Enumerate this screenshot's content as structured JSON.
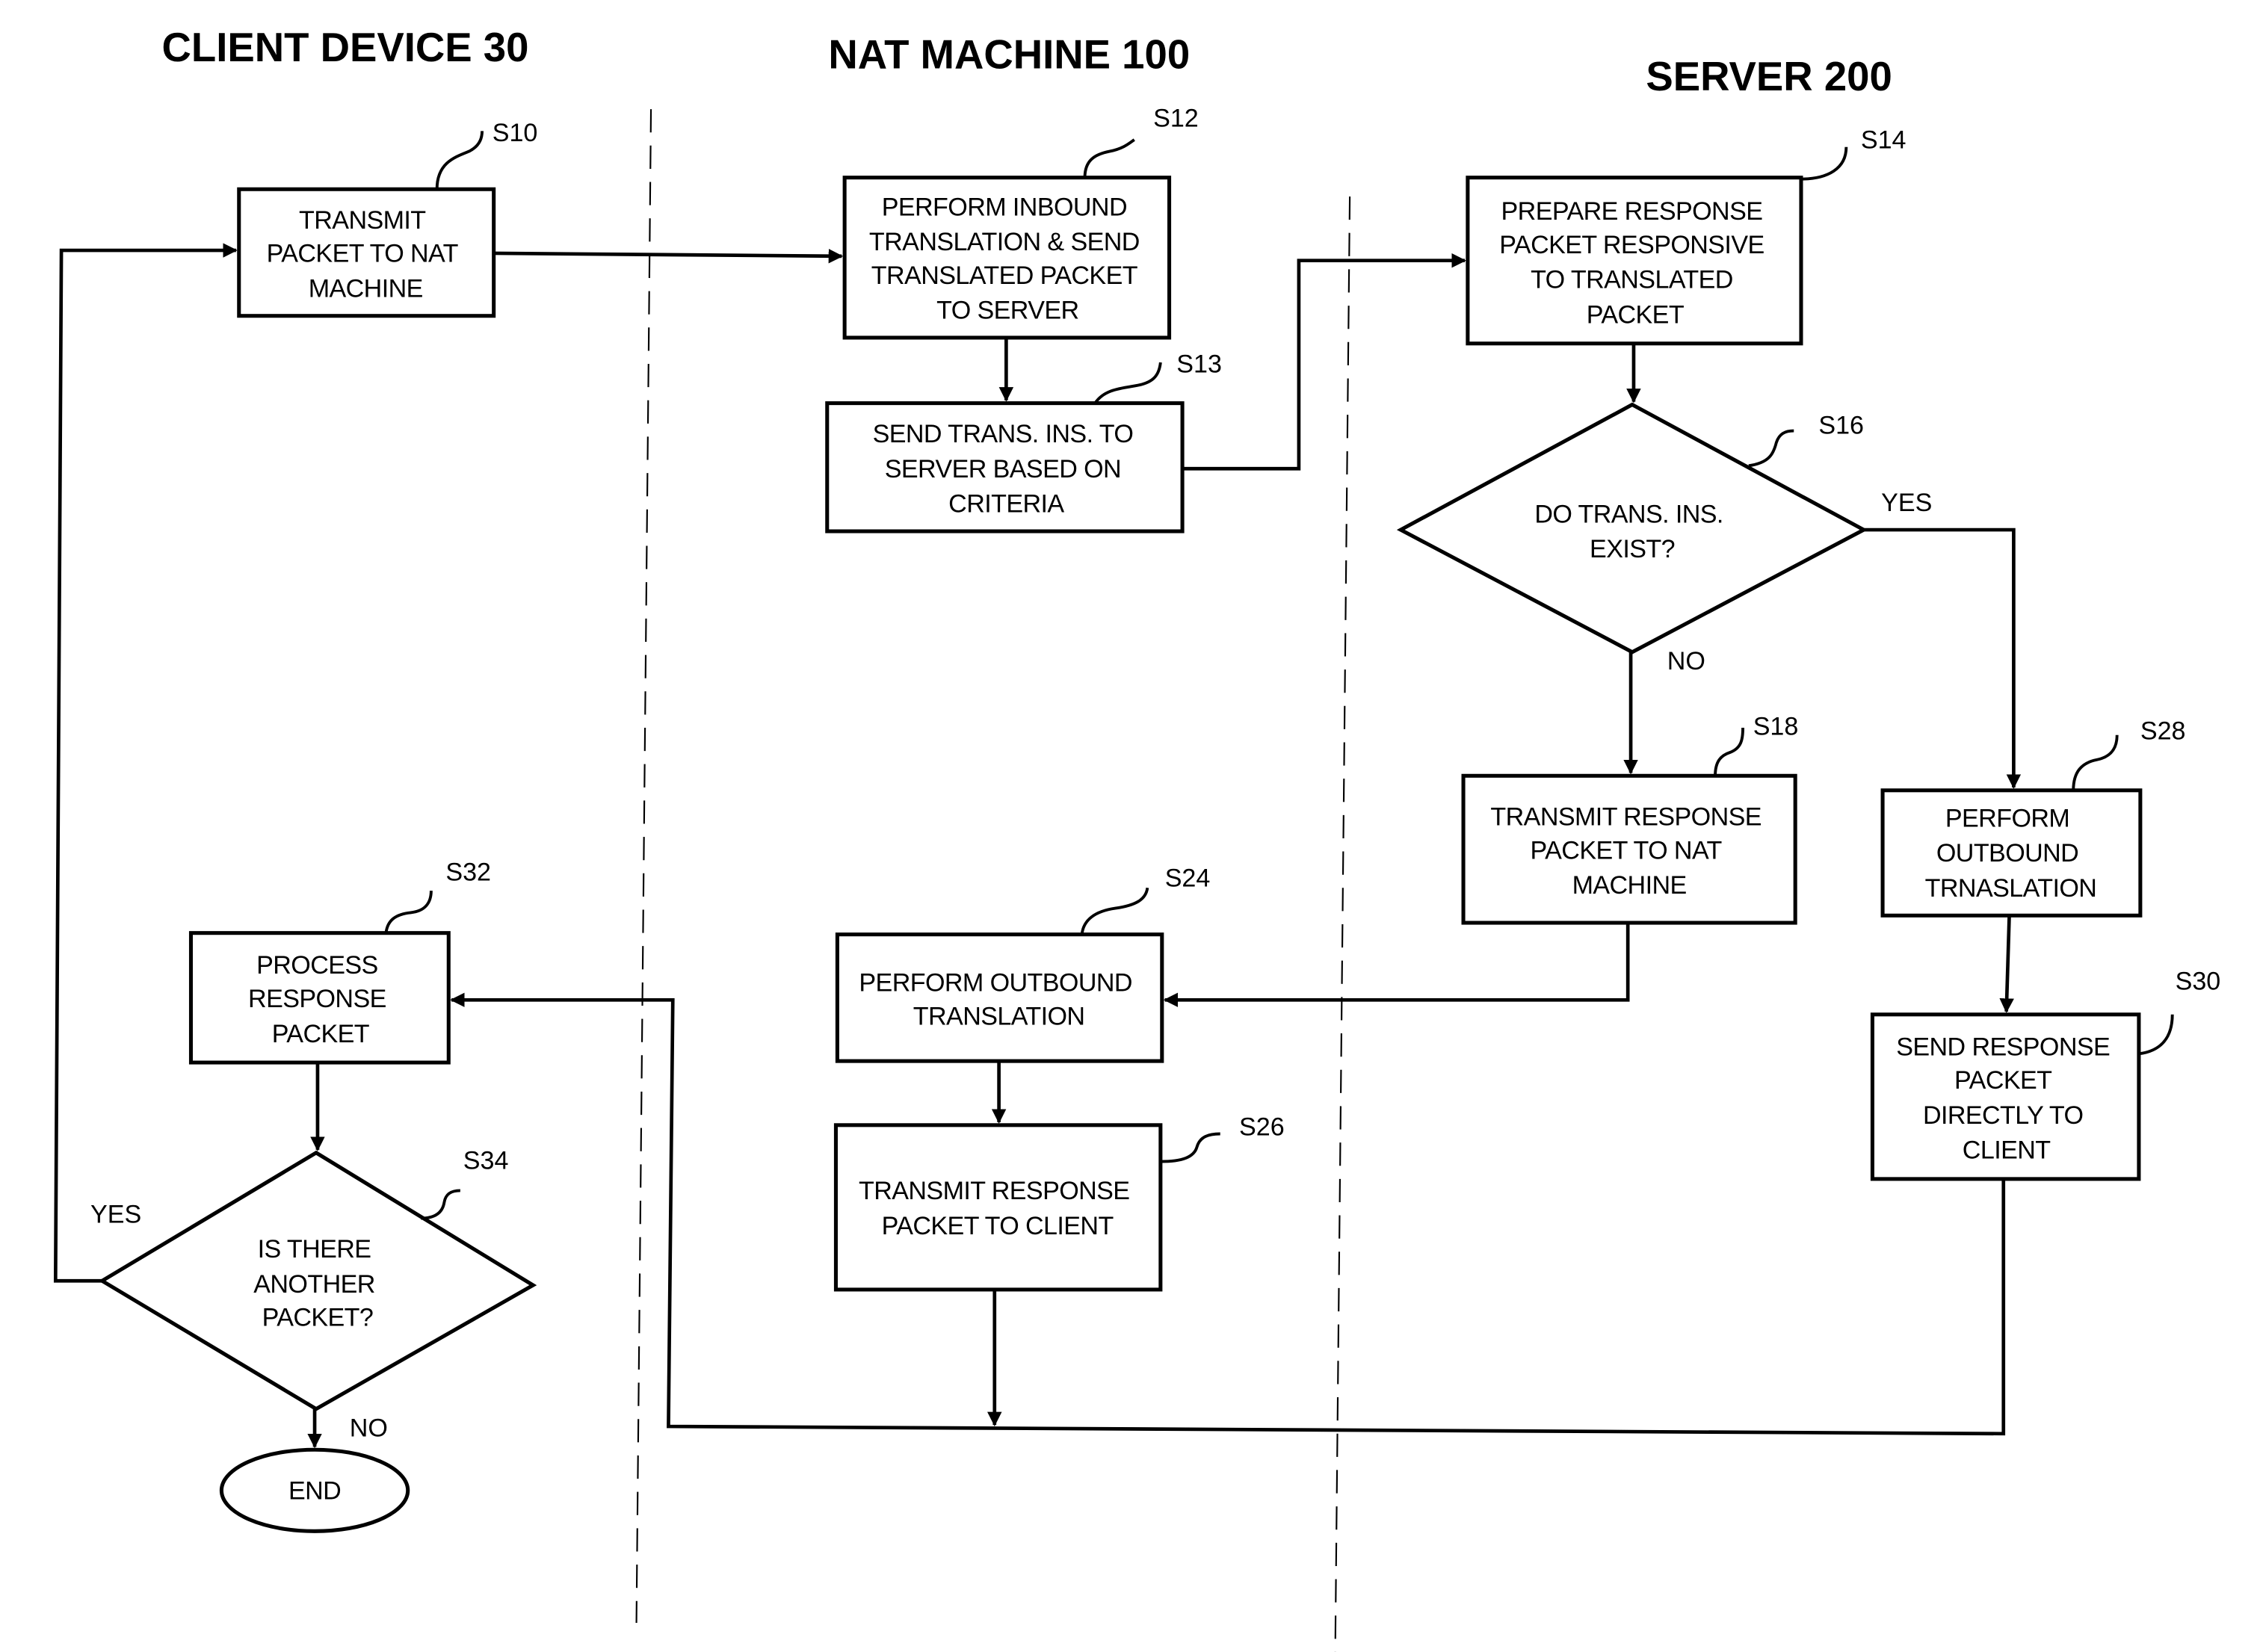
{
  "lanes": [
    {
      "id": "client",
      "title": "CLIENT DEVICE 30"
    },
    {
      "id": "nat",
      "title": "NAT MACHINE 100"
    },
    {
      "id": "server",
      "title": "SERVER 200"
    }
  ],
  "steps": {
    "S10": {
      "ref": "S10",
      "lines": [
        "TRANSMIT",
        "PACKET TO NAT",
        "MACHINE"
      ]
    },
    "S12": {
      "ref": "S12",
      "lines": [
        "PERFORM INBOUND",
        "TRANSLATION & SEND",
        "TRANSLATED PACKET",
        "TO SERVER"
      ]
    },
    "S13": {
      "ref": "S13",
      "lines": [
        "SEND TRANS. INS. TO",
        "SERVER BASED ON",
        "CRITERIA"
      ]
    },
    "S14": {
      "ref": "S14",
      "lines": [
        "PREPARE RESPONSE",
        "PACKET RESPONSIVE",
        "TO TRANSLATED",
        "PACKET"
      ]
    },
    "S16": {
      "ref": "S16",
      "lines": [
        "DO TRANS. INS.",
        "EXIST?"
      ]
    },
    "S18": {
      "ref": "S18",
      "lines": [
        "TRANSMIT RESPONSE",
        "PACKET TO NAT",
        "MACHINE"
      ]
    },
    "S24": {
      "ref": "S24",
      "lines": [
        "PERFORM OUTBOUND",
        "TRANSLATION"
      ]
    },
    "S26": {
      "ref": "S26",
      "lines": [
        "TRANSMIT RESPONSE",
        "PACKET TO CLIENT"
      ]
    },
    "S28": {
      "ref": "S28",
      "lines": [
        "PERFORM",
        "OUTBOUND",
        "TRNASLATION"
      ]
    },
    "S30": {
      "ref": "S30",
      "lines": [
        "SEND RESPONSE",
        "PACKET",
        "DIRECTLY TO",
        "CLIENT"
      ]
    },
    "S32": {
      "ref": "S32",
      "lines": [
        "PROCESS",
        "RESPONSE",
        "PACKET"
      ]
    },
    "S34": {
      "ref": "S34",
      "lines": [
        "IS THERE",
        "ANOTHER",
        "PACKET?"
      ]
    },
    "END": {
      "lines": [
        "END"
      ]
    }
  },
  "branches": {
    "S16_yes": "YES",
    "S16_no": "NO",
    "S34_yes": "YES",
    "S34_no": "NO"
  }
}
